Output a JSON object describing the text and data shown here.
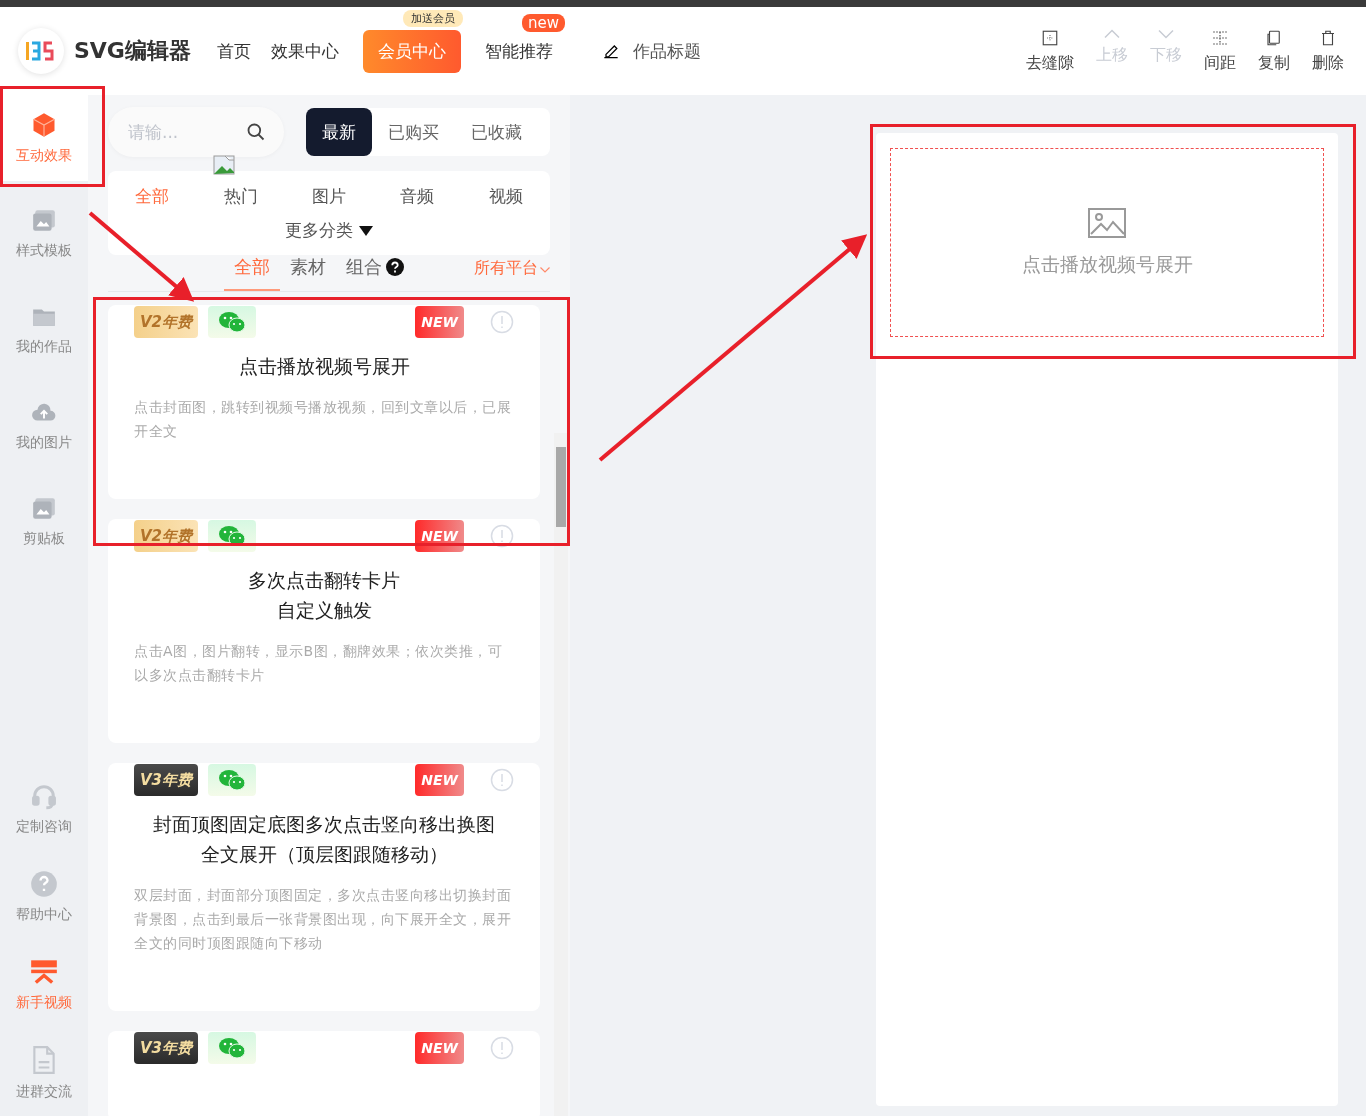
{
  "header": {
    "logo_text": "SVG编辑器",
    "nav": [
      {
        "label": "首页",
        "kind": "link"
      },
      {
        "label": "效果中心",
        "kind": "link"
      },
      {
        "label": "会员中心",
        "kind": "promo",
        "badge": "加送会员"
      },
      {
        "label": "智能推荐",
        "kind": "link",
        "badge": "new"
      }
    ],
    "title_field": {
      "placeholder": "作品标题"
    },
    "tools": [
      {
        "label": "去缝隙",
        "disabled": false
      },
      {
        "label": "上移",
        "disabled": true
      },
      {
        "label": "下移",
        "disabled": true
      },
      {
        "label": "间距",
        "disabled": false
      },
      {
        "label": "复制",
        "disabled": false
      },
      {
        "label": "删除",
        "disabled": false
      }
    ]
  },
  "sidebar": {
    "top_items": [
      {
        "label": "互动效果",
        "selected": true,
        "highlighted": true
      },
      {
        "label": "样式模板",
        "selected": false,
        "highlighted": false
      },
      {
        "label": "我的作品",
        "selected": false,
        "highlighted": false
      },
      {
        "label": "我的图片",
        "selected": false,
        "highlighted": false
      },
      {
        "label": "剪贴板",
        "selected": false,
        "highlighted": false
      }
    ],
    "bottom_items": [
      {
        "label": "定制咨询",
        "selected": false,
        "highlighted": false
      },
      {
        "label": "帮助中心",
        "selected": false,
        "highlighted": false
      },
      {
        "label": "新手视频",
        "selected": false,
        "highlighted": true
      },
      {
        "label": "进群交流",
        "selected": false,
        "highlighted": false
      }
    ]
  },
  "panel": {
    "search": {
      "placeholder": "请输..."
    },
    "sort_tabs": [
      {
        "label": "最新",
        "selected": true
      },
      {
        "label": "已购买",
        "selected": false
      },
      {
        "label": "已收藏",
        "selected": false
      }
    ],
    "categories": [
      {
        "label": "全部",
        "selected": true
      },
      {
        "label": "热门",
        "selected": false
      },
      {
        "label": "图片",
        "selected": false
      },
      {
        "label": "音频",
        "selected": false
      },
      {
        "label": "视频",
        "selected": false
      }
    ],
    "more_categories": "更多分类",
    "type_tabs": [
      {
        "label": "全部",
        "selected": true,
        "help": false
      },
      {
        "label": "素材",
        "selected": false,
        "help": false
      },
      {
        "label": "组合",
        "selected": false,
        "help": true
      }
    ],
    "platform": "所有平台",
    "cards": [
      {
        "version": "V2年费",
        "kind": "v2",
        "new_badge": "NEW",
        "title_lines": [
          "点击播放视频号展开"
        ],
        "description": "点击封面图，跳转到视频号播放视频，回到文章以后，已展开全文"
      },
      {
        "version": "V2年费",
        "kind": "v2",
        "new_badge": "NEW",
        "title_lines": [
          "多次点击翻转卡片",
          "自定义触发"
        ],
        "description": "点击A图，图片翻转，显示B图，翻牌效果；依次类推，可以多次点击翻转卡片"
      },
      {
        "version": "V3年费",
        "kind": "v3",
        "new_badge": "NEW",
        "title_lines": [
          "封面顶图固定底图多次点击竖向移出换图",
          "全文展开（顶层图跟随移动）"
        ],
        "description": "双层封面，封面部分顶图固定，多次点击竖向移出切换封面背景图，点击到最后一张背景图出现，向下展开全文，展开全文的同时顶图跟随向下移动"
      },
      {
        "version": "V3年费",
        "kind": "v3",
        "new_badge": "NEW"
      }
    ]
  },
  "canvas": {
    "placeholder_text": "点击播放视频号展开"
  }
}
